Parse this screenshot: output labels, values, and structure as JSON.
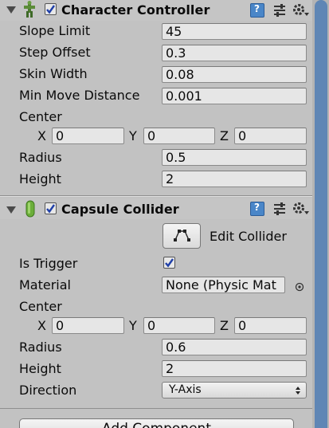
{
  "character_controller": {
    "title": "Character Controller",
    "slope_limit": {
      "label": "Slope Limit",
      "value": "45"
    },
    "step_offset": {
      "label": "Step Offset",
      "value": "0.3"
    },
    "skin_width": {
      "label": "Skin Width",
      "value": "0.08"
    },
    "min_move_distance": {
      "label": "Min Move Distance",
      "value": "0.001"
    },
    "center": {
      "label": "Center",
      "x_label": "X",
      "x": "0",
      "y_label": "Y",
      "y": "0",
      "z_label": "Z",
      "z": "0"
    },
    "radius": {
      "label": "Radius",
      "value": "0.5"
    },
    "height": {
      "label": "Height",
      "value": "2"
    }
  },
  "capsule_collider": {
    "title": "Capsule Collider",
    "edit_collider_label": "Edit Collider",
    "is_trigger": {
      "label": "Is Trigger",
      "checked": true
    },
    "material": {
      "label": "Material",
      "value": "None (Physic Mat"
    },
    "center": {
      "label": "Center",
      "x_label": "X",
      "x": "0",
      "y_label": "Y",
      "y": "0",
      "z_label": "Z",
      "z": "0"
    },
    "radius": {
      "label": "Radius",
      "value": "0.6"
    },
    "height": {
      "label": "Height",
      "value": "2"
    },
    "direction": {
      "label": "Direction",
      "value": "Y-Axis"
    }
  },
  "add_component": {
    "label": "Add Component"
  },
  "icons": {
    "cc_component": "character-controller-icon",
    "capsule_component": "capsule-icon",
    "help": "help-icon",
    "preset": "preset-icon",
    "settings": "gear-icon",
    "edit_collider": "edit-collider-icon",
    "object_picker": "object-picker-icon"
  },
  "colors": {
    "panel_bg": "#c2c2c2",
    "field_bg": "#e6e6e6",
    "help_blue": "#4a86c8",
    "scrollbar": "#5f86b5",
    "checkbox_mark": "#1f3fa8"
  }
}
